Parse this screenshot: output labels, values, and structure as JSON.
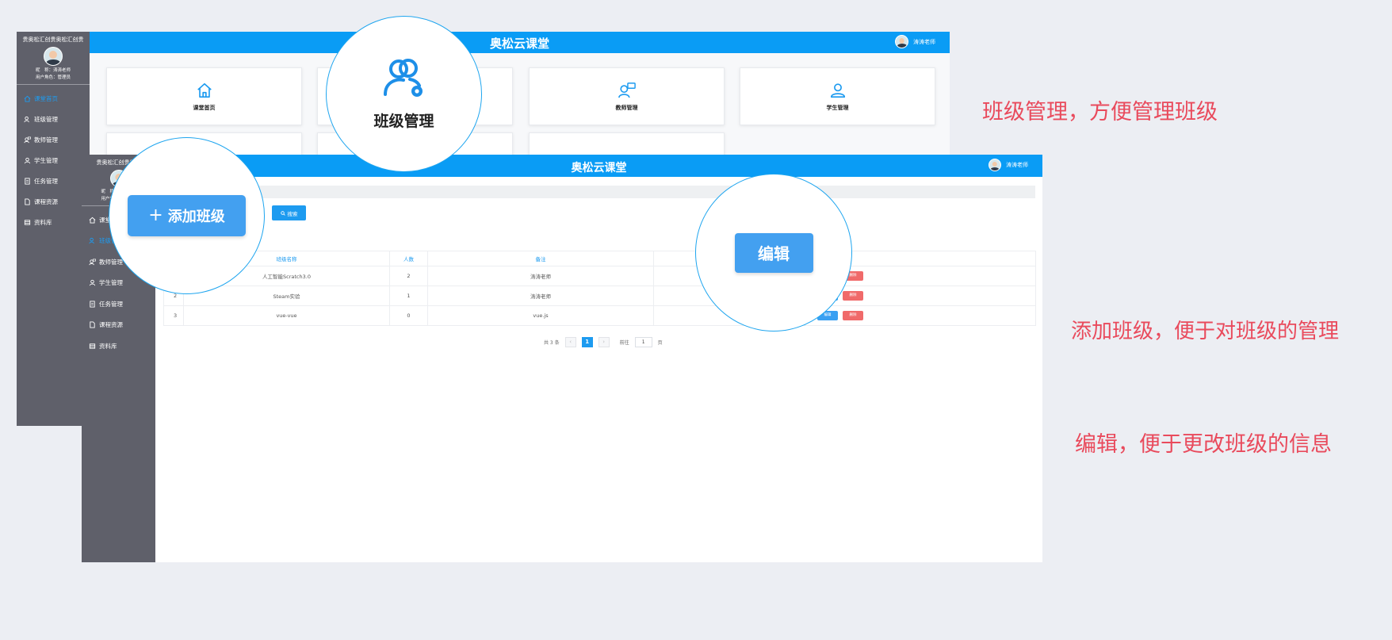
{
  "app_title": "奥松云课堂",
  "user": {
    "name": "涛涛老师"
  },
  "back_window": {
    "brand": "贵奥松汇创贵奥松汇创贵",
    "user_lines": [
      "昵　称：涛涛老师",
      "用户角色：管理员"
    ],
    "menu": [
      {
        "label": "课堂首页",
        "icon": "home-icon",
        "active": true
      },
      {
        "label": "班级管理",
        "icon": "class-icon",
        "active": false
      },
      {
        "label": "教师管理",
        "icon": "teacher-icon",
        "active": false
      },
      {
        "label": "学生管理",
        "icon": "student-icon",
        "active": false
      },
      {
        "label": "任务管理",
        "icon": "task-icon",
        "active": false
      },
      {
        "label": "课程资源",
        "icon": "resource-icon",
        "active": false
      },
      {
        "label": "资料库",
        "icon": "library-icon",
        "active": false
      }
    ],
    "tiles": [
      {
        "label": "课堂首页",
        "icon": "home-icon"
      },
      {
        "label": "教师管理",
        "icon": "teacher-icon"
      },
      {
        "label": "学生管理",
        "icon": "student-icon"
      }
    ]
  },
  "front_window": {
    "brand": "贵奥松汇创贵奥松",
    "menu": [
      {
        "label": "课堂",
        "icon": "home-icon",
        "active": false
      },
      {
        "label": "班级管",
        "icon": "class-icon",
        "active": true
      },
      {
        "label": "教师管理",
        "icon": "teacher-icon",
        "active": false
      },
      {
        "label": "学生管理",
        "icon": "student-icon",
        "active": false
      },
      {
        "label": "任务管理",
        "icon": "task-icon",
        "active": false
      },
      {
        "label": "课程资源",
        "icon": "resource-icon",
        "active": false
      },
      {
        "label": "资料库",
        "icon": "library-icon",
        "active": false
      }
    ],
    "search_label": "搜索",
    "table": {
      "columns": [
        "",
        "班级名称",
        "人数",
        "备注",
        ""
      ],
      "rows": [
        {
          "no": "",
          "name": "人工智能Scratch3.0",
          "count": "2",
          "note": "涛涛老师"
        },
        {
          "no": "2",
          "name": "Steam实验",
          "count": "1",
          "note": "涛涛老师"
        },
        {
          "no": "3",
          "name": "vue-vue",
          "count": "0",
          "note": "vue.js"
        }
      ],
      "edit_label": "编辑",
      "delete_label": "删除"
    },
    "pagination": {
      "total_text": "共 3 条",
      "prev": "‹",
      "current_page": "1",
      "next": "›",
      "goto_label": "前往",
      "goto_value": "1",
      "page_suffix": "页"
    }
  },
  "callouts": {
    "class_mgmt": "班级管理",
    "add_class": "添加班级",
    "edit": "编辑"
  },
  "notes": [
    "班级管理，方便管理班级",
    "添加班级，便于对班级的管理",
    "编辑，便于更改班级的信息"
  ],
  "colors": {
    "accent": "#0a9cf5",
    "sidebar": "#5f606a",
    "note": "#e94a5c",
    "danger": "#f06a6a"
  }
}
